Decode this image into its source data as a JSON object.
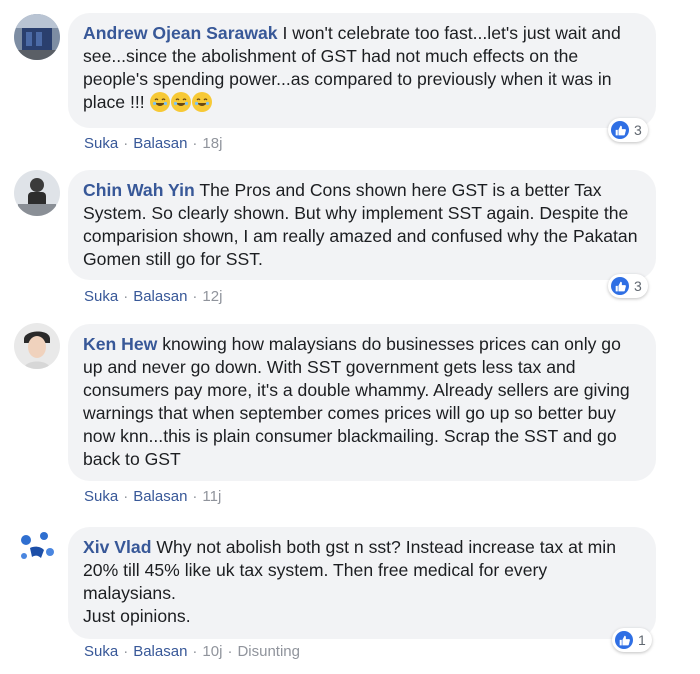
{
  "comments": [
    {
      "author": "Andrew Ojean Sarawak",
      "text": " I won't celebrate too fast...let's just wait and see...since the abolishment of GST had not much effects on the people's spending power...as compared to previously when it was in place !!! ",
      "emoji": [
        "laughing-tears-emoji",
        "laughing-tears-emoji",
        "laughing-tears-emoji"
      ],
      "like_label": "Suka",
      "reply_label": "Balasan",
      "time": "18j",
      "reaction_count": "3"
    },
    {
      "author": "Chin Wah Yin",
      "text": " The Pros and Cons shown here GST is a better Tax System. So clearly shown. But why implement SST again. Despite the comparision shown, I am really amazed and confused why the Pakatan Gomen still go for SST.",
      "like_label": "Suka",
      "reply_label": "Balasan",
      "time": "12j",
      "reaction_count": "3"
    },
    {
      "author": "Ken Hew",
      "text": " knowing how malaysians do businesses prices can only go up and never go down. With SST government gets less tax and consumers pay more, it's a double whammy. Already sellers are giving warnings that when september comes prices will go up so better buy now knn...this is plain consumer blackmailing. Scrap the SST and go back to GST",
      "like_label": "Suka",
      "reply_label": "Balasan",
      "time": "11j"
    },
    {
      "author": "Xiv Vlad",
      "text": " Why not abolish both gst n sst? Instead increase tax at min 20% till 45% like uk tax system. Then free medical for every malaysians.",
      "text2": "Just opinions.",
      "like_label": "Suka",
      "reply_label": "Balasan",
      "time": "10j",
      "edited_label": "Disunting",
      "reaction_count": "1"
    }
  ],
  "colors": {
    "author": "#385898",
    "bubble": "#f2f3f5",
    "like_icon": "#2f6fe4",
    "meta": "#90949c"
  }
}
